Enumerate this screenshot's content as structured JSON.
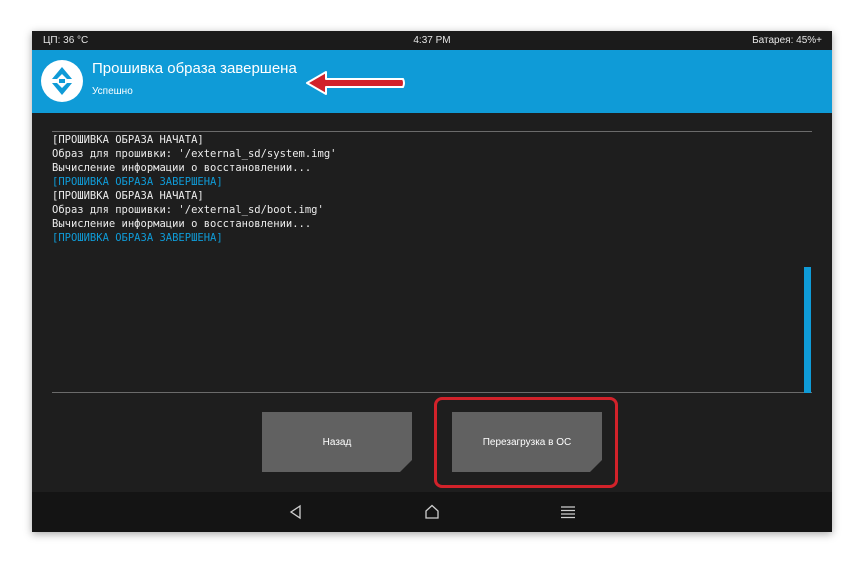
{
  "status_bar": {
    "cpu": "ЦП: 36 °C",
    "time": "4:37 PM",
    "battery": "Батарея: 45%+"
  },
  "header": {
    "title": "Прошивка образа завершена",
    "subtitle": "Успешно"
  },
  "console": {
    "lines": [
      {
        "text": "[ПРОШИВКА ОБРАЗА НАЧАТА]",
        "highlight": false
      },
      {
        "text": "Образ для прошивки: '/external_sd/system.img'",
        "highlight": false
      },
      {
        "text": "Вычисление информации о восстановлении...",
        "highlight": false
      },
      {
        "text": "[ПРОШИВКА ОБРАЗА ЗАВЕРШЕНА]",
        "highlight": true
      },
      {
        "text": "[ПРОШИВКА ОБРАЗА НАЧАТА]",
        "highlight": false
      },
      {
        "text": "Образ для прошивки: '/external_sd/boot.img'",
        "highlight": false
      },
      {
        "text": "Вычисление информации о восстановлении...",
        "highlight": false
      },
      {
        "text": "[ПРОШИВКА ОБРАЗА ЗАВЕРШЕНА]",
        "highlight": true
      }
    ]
  },
  "buttons": {
    "back": "Назад",
    "reboot": "Перезагрузка в ОС"
  },
  "navigation": {
    "icons": [
      "back-triangle-icon",
      "home-icon",
      "menu-icon"
    ]
  },
  "colors": {
    "accent": "#0f9bd7",
    "annotation": "#d2222a",
    "background": "#1e1e1e",
    "button": "#616161"
  }
}
